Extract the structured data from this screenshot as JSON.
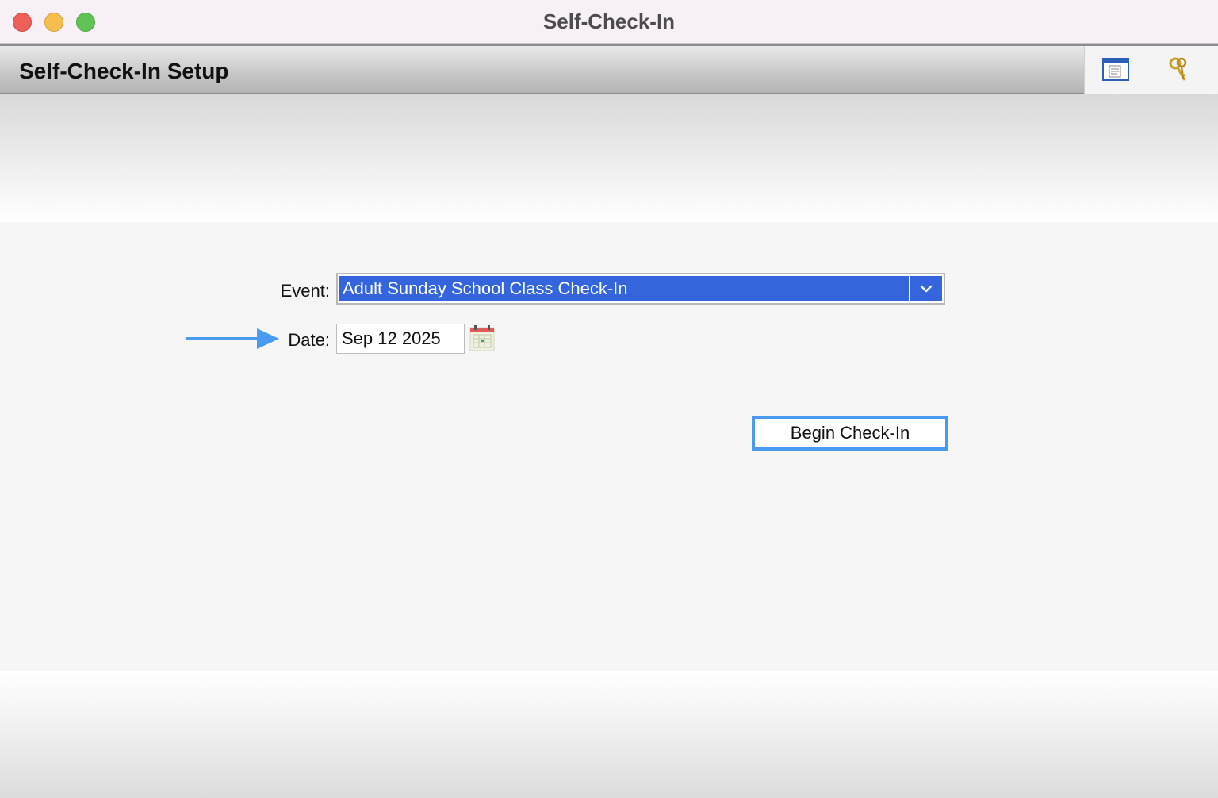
{
  "window": {
    "title": "Self-Check-In"
  },
  "header": {
    "title": "Self-Check-In Setup",
    "tools": [
      "report-icon",
      "keys-icon"
    ]
  },
  "form": {
    "event_label": "Event:",
    "event_value": "Adult Sunday School Class Check-In",
    "date_label": "Date:",
    "date_value": "Sep 12 2025"
  },
  "actions": {
    "begin_label": "Begin Check-In"
  },
  "colors": {
    "select_highlight": "#3465dc",
    "focus_ring": "#4a9bf0",
    "annotation_arrow": "#4a9bf0"
  }
}
